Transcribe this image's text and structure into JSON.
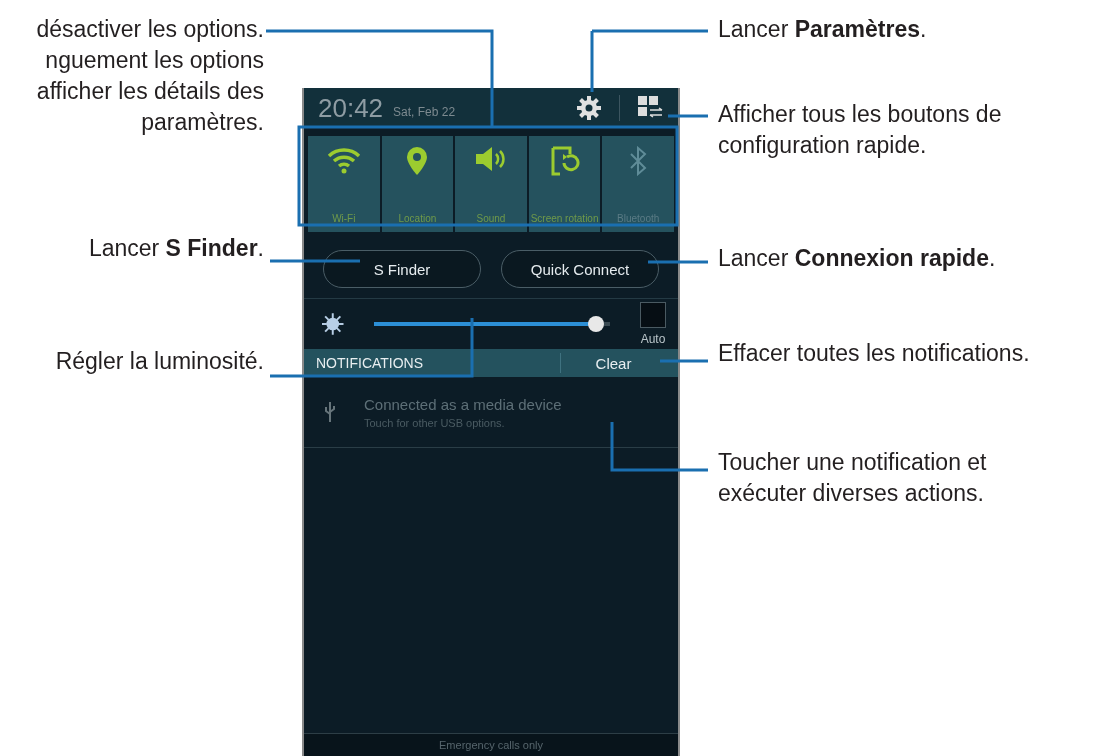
{
  "callouts_left": [
    {
      "lines": [
        "désactiver les options.",
        "nguement les options",
        "afficher les détails des",
        "paramètres."
      ]
    },
    {
      "lines": [
        "Lancer **S Finder**."
      ]
    },
    {
      "lines": [
        "Régler la luminosité."
      ]
    }
  ],
  "phone": {
    "status_bar": {
      "time": "20:42",
      "date": "Sat, Feb 22"
    },
    "quick_settings": [
      {
        "label": "Wi-Fi",
        "kind": "wifi",
        "on": true
      },
      {
        "label": "Location",
        "kind": "location",
        "on": true
      },
      {
        "label": "Sound",
        "kind": "sound",
        "on": true
      },
      {
        "label": "Screen rotation",
        "kind": "rotation",
        "on": true
      },
      {
        "label": "Bluetooth",
        "kind": "bluetooth",
        "on": false
      }
    ],
    "buttons": [
      "S Finder",
      "Quick Connect"
    ],
    "brightness": {
      "level": 0.94,
      "auto": {
        "label": "Auto",
        "checked": false
      }
    },
    "notifications": {
      "title": "NOTIFICATIONS",
      "clear": "Clear",
      "items": [
        {
          "title": "Connected as a media device",
          "subtitle": "Touch for other USB options."
        }
      ]
    },
    "footer": "Emergency calls only"
  },
  "callouts_right": [
    {
      "lines": [
        "Lancer **Paramètres**."
      ]
    },
    {
      "lines": [
        "Afficher tous les boutons de",
        "configuration rapide."
      ]
    },
    {
      "lines": [
        "Lancer **Connexion rapide**."
      ]
    },
    {
      "lines": [
        "Effacer toutes les notifications."
      ]
    },
    {
      "lines": [
        "Toucher une notification et",
        "exécuter diverses actions."
      ]
    }
  ]
}
